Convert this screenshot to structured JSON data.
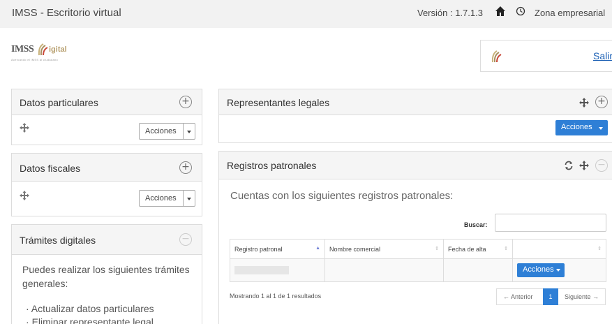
{
  "topbar": {
    "title": "IMSS - Escritorio virtual",
    "version": "Versión : 1.7.1.3",
    "zona": "Zona empresarial",
    "icons": {
      "home": "home-icon",
      "clock": "clock-icon"
    }
  },
  "logo": {
    "imss": "IMSS",
    "digital": "igital",
    "tagline": "Acercando el IMSS al ciudadano"
  },
  "userbox": {
    "salir": "Salir"
  },
  "left_panels": {
    "datos_particulares": {
      "title": "Datos particulares",
      "actions": "Acciones"
    },
    "datos_fiscales": {
      "title": "Datos fiscales",
      "actions": "Acciones"
    },
    "tramites": {
      "title": "Trámites digitales",
      "intro": "Puedes realizar los siguientes trámites generales:",
      "items": [
        "Actualizar datos particulares",
        "Eliminar representante legal"
      ]
    }
  },
  "representantes": {
    "title": "Representantes legales",
    "actions": "Acciones"
  },
  "registros": {
    "title": "Registros patronales",
    "subtitle": "Cuentas con los siguientes registros patronales:",
    "search_label": "Buscar:",
    "search_value": "",
    "columns": [
      "Registro patronal",
      "Nombre comercial",
      "Fecha de alta",
      ""
    ],
    "row_actions": "Acciones",
    "summary": "Mostrando 1 al 1 de 1 resultados",
    "pagination": {
      "prev": "← Anterior",
      "page": "1",
      "next": "Siguiente →"
    }
  },
  "colors": {
    "accent": "#2e7fd6",
    "panel_header": "#f5f5f5",
    "link": "#1a5fb4"
  }
}
